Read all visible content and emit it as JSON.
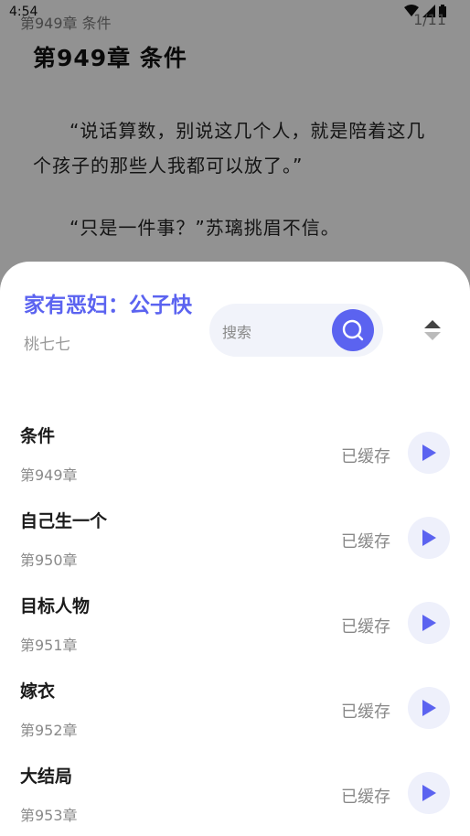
{
  "status_bar": {
    "time": "4:54"
  },
  "reader": {
    "running_header": "第949章 条件",
    "page_number": "1/11",
    "chapter_title": "第949章 条件",
    "paragraphs": [
      "“说话算数，别说这几个人，就是陪着这几个孩子的那些人我都可以放了。”",
      "“只是一件事？”苏璃挑眉不信。"
    ]
  },
  "sheet": {
    "book_title": "家有恶妇：公子快",
    "author": "桃七七",
    "search": {
      "placeholder": "搜索"
    },
    "chapters": [
      {
        "name": "条件",
        "number": "第949章",
        "status": "已缓存"
      },
      {
        "name": "自己生一个",
        "number": "第950章",
        "status": "已缓存"
      },
      {
        "name": "目标人物",
        "number": "第951章",
        "status": "已缓存"
      },
      {
        "name": "嫁衣",
        "number": "第952章",
        "status": "已缓存"
      },
      {
        "name": "大结局",
        "number": "第953章",
        "status": "已缓存"
      }
    ]
  },
  "colors": {
    "accent": "#5b63f0",
    "muted": "#888888"
  }
}
